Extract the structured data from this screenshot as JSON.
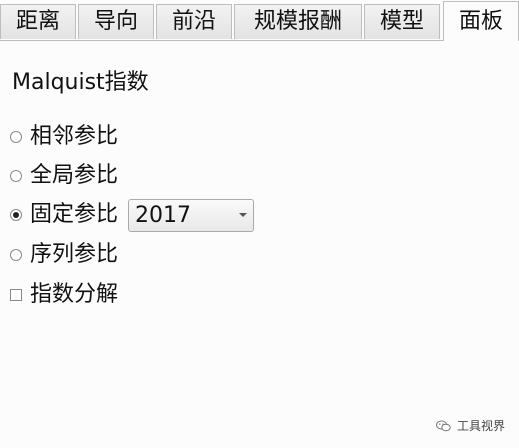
{
  "tabs": [
    {
      "label": "距离"
    },
    {
      "label": "导向"
    },
    {
      "label": "前沿"
    },
    {
      "label": "规模报酬"
    },
    {
      "label": "模型"
    },
    {
      "label": "面板"
    }
  ],
  "active_tab": "面板",
  "panel": {
    "title": "Malquist指数",
    "options": [
      {
        "label": "相邻参比",
        "checked": false
      },
      {
        "label": "全局参比",
        "checked": false
      },
      {
        "label": "固定参比",
        "checked": true
      },
      {
        "label": "序列参比",
        "checked": false
      }
    ],
    "year_select": {
      "value": "2017"
    },
    "decompose": {
      "label": "指数分解",
      "checked": false
    }
  },
  "watermark": {
    "text": "工具视界",
    "icon": "wechat-icon"
  }
}
